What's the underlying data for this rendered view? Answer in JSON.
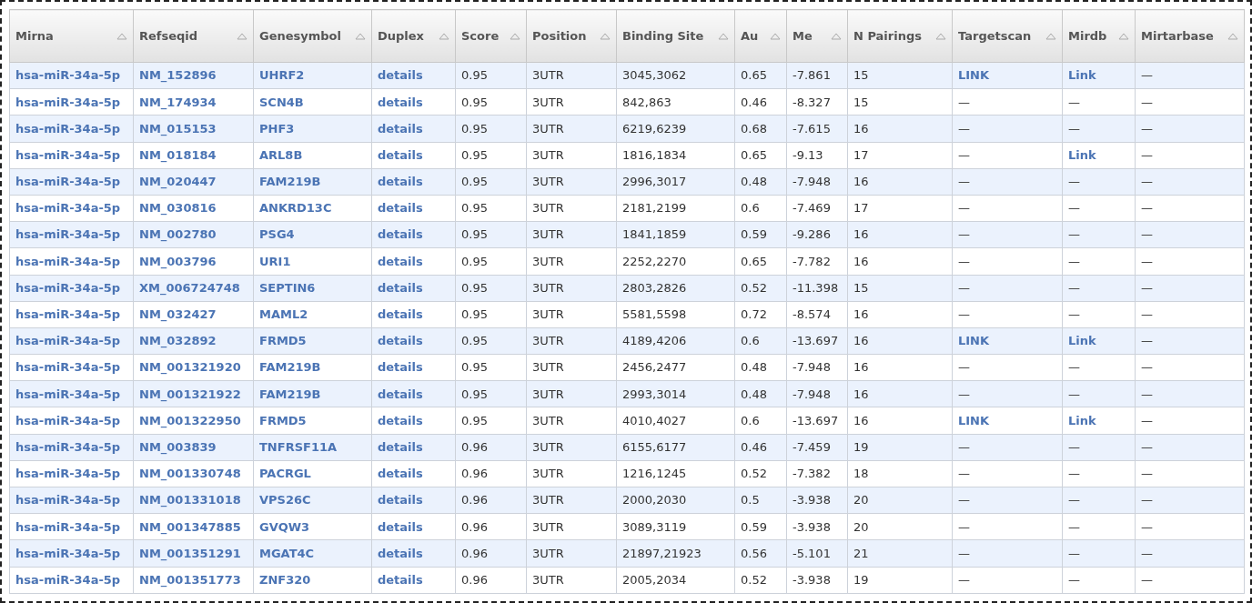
{
  "table": {
    "columns": [
      {
        "label": "Mirna",
        "kind": "link"
      },
      {
        "label": "Refseqid",
        "kind": "link"
      },
      {
        "label": "Genesymbol",
        "kind": "link"
      },
      {
        "label": "Duplex",
        "kind": "link"
      },
      {
        "label": "Score",
        "kind": "text"
      },
      {
        "label": "Position",
        "kind": "text"
      },
      {
        "label": "Binding Site",
        "kind": "text"
      },
      {
        "label": "Au",
        "kind": "text"
      },
      {
        "label": "Me",
        "kind": "text"
      },
      {
        "label": "N Pairings",
        "kind": "text"
      },
      {
        "label": "Targetscan",
        "kind": "mixed"
      },
      {
        "label": "Mirdb",
        "kind": "mixed"
      },
      {
        "label": "Mirtarbase",
        "kind": "mixed"
      }
    ],
    "rows": [
      [
        "hsa-miR-34a-5p",
        "NM_152896",
        "UHRF2",
        "details",
        "0.95",
        "3UTR",
        "3045,3062",
        "0.65",
        "-7.861",
        "15",
        {
          "text": "LINK",
          "link": true
        },
        {
          "text": "Link",
          "link": true
        },
        {
          "text": "—",
          "link": false
        }
      ],
      [
        "hsa-miR-34a-5p",
        "NM_174934",
        "SCN4B",
        "details",
        "0.95",
        "3UTR",
        "842,863",
        "0.46",
        "-8.327",
        "15",
        {
          "text": "—",
          "link": false
        },
        {
          "text": "—",
          "link": false
        },
        {
          "text": "—",
          "link": false
        }
      ],
      [
        "hsa-miR-34a-5p",
        "NM_015153",
        "PHF3",
        "details",
        "0.95",
        "3UTR",
        "6219,6239",
        "0.68",
        "-7.615",
        "16",
        {
          "text": "—",
          "link": false
        },
        {
          "text": "—",
          "link": false
        },
        {
          "text": "—",
          "link": false
        }
      ],
      [
        "hsa-miR-34a-5p",
        "NM_018184",
        "ARL8B",
        "details",
        "0.95",
        "3UTR",
        "1816,1834",
        "0.65",
        "-9.13",
        "17",
        {
          "text": "—",
          "link": false
        },
        {
          "text": "Link",
          "link": true
        },
        {
          "text": "—",
          "link": false
        }
      ],
      [
        "hsa-miR-34a-5p",
        "NM_020447",
        "FAM219B",
        "details",
        "0.95",
        "3UTR",
        "2996,3017",
        "0.48",
        "-7.948",
        "16",
        {
          "text": "—",
          "link": false
        },
        {
          "text": "—",
          "link": false
        },
        {
          "text": "—",
          "link": false
        }
      ],
      [
        "hsa-miR-34a-5p",
        "NM_030816",
        "ANKRD13C",
        "details",
        "0.95",
        "3UTR",
        "2181,2199",
        "0.6",
        "-7.469",
        "17",
        {
          "text": "—",
          "link": false
        },
        {
          "text": "—",
          "link": false
        },
        {
          "text": "—",
          "link": false
        }
      ],
      [
        "hsa-miR-34a-5p",
        "NM_002780",
        "PSG4",
        "details",
        "0.95",
        "3UTR",
        "1841,1859",
        "0.59",
        "-9.286",
        "16",
        {
          "text": "—",
          "link": false
        },
        {
          "text": "—",
          "link": false
        },
        {
          "text": "—",
          "link": false
        }
      ],
      [
        "hsa-miR-34a-5p",
        "NM_003796",
        "URI1",
        "details",
        "0.95",
        "3UTR",
        "2252,2270",
        "0.65",
        "-7.782",
        "16",
        {
          "text": "—",
          "link": false
        },
        {
          "text": "—",
          "link": false
        },
        {
          "text": "—",
          "link": false
        }
      ],
      [
        "hsa-miR-34a-5p",
        "XM_006724748",
        "SEPTIN6",
        "details",
        "0.95",
        "3UTR",
        "2803,2826",
        "0.52",
        "-11.398",
        "15",
        {
          "text": "—",
          "link": false
        },
        {
          "text": "—",
          "link": false
        },
        {
          "text": "—",
          "link": false
        }
      ],
      [
        "hsa-miR-34a-5p",
        "NM_032427",
        "MAML2",
        "details",
        "0.95",
        "3UTR",
        "5581,5598",
        "0.72",
        "-8.574",
        "16",
        {
          "text": "—",
          "link": false
        },
        {
          "text": "—",
          "link": false
        },
        {
          "text": "—",
          "link": false
        }
      ],
      [
        "hsa-miR-34a-5p",
        "NM_032892",
        "FRMD5",
        "details",
        "0.95",
        "3UTR",
        "4189,4206",
        "0.6",
        "-13.697",
        "16",
        {
          "text": "LINK",
          "link": true
        },
        {
          "text": "Link",
          "link": true
        },
        {
          "text": "—",
          "link": false
        }
      ],
      [
        "hsa-miR-34a-5p",
        "NM_001321920",
        "FAM219B",
        "details",
        "0.95",
        "3UTR",
        "2456,2477",
        "0.48",
        "-7.948",
        "16",
        {
          "text": "—",
          "link": false
        },
        {
          "text": "—",
          "link": false
        },
        {
          "text": "—",
          "link": false
        }
      ],
      [
        "hsa-miR-34a-5p",
        "NM_001321922",
        "FAM219B",
        "details",
        "0.95",
        "3UTR",
        "2993,3014",
        "0.48",
        "-7.948",
        "16",
        {
          "text": "—",
          "link": false
        },
        {
          "text": "—",
          "link": false
        },
        {
          "text": "—",
          "link": false
        }
      ],
      [
        "hsa-miR-34a-5p",
        "NM_001322950",
        "FRMD5",
        "details",
        "0.95",
        "3UTR",
        "4010,4027",
        "0.6",
        "-13.697",
        "16",
        {
          "text": "LINK",
          "link": true
        },
        {
          "text": "Link",
          "link": true
        },
        {
          "text": "—",
          "link": false
        }
      ],
      [
        "hsa-miR-34a-5p",
        "NM_003839",
        "TNFRSF11A",
        "details",
        "0.96",
        "3UTR",
        "6155,6177",
        "0.46",
        "-7.459",
        "19",
        {
          "text": "—",
          "link": false
        },
        {
          "text": "—",
          "link": false
        },
        {
          "text": "—",
          "link": false
        }
      ],
      [
        "hsa-miR-34a-5p",
        "NM_001330748",
        "PACRGL",
        "details",
        "0.96",
        "3UTR",
        "1216,1245",
        "0.52",
        "-7.382",
        "18",
        {
          "text": "—",
          "link": false
        },
        {
          "text": "—",
          "link": false
        },
        {
          "text": "—",
          "link": false
        }
      ],
      [
        "hsa-miR-34a-5p",
        "NM_001331018",
        "VPS26C",
        "details",
        "0.96",
        "3UTR",
        "2000,2030",
        "0.5",
        "-3.938",
        "20",
        {
          "text": "—",
          "link": false
        },
        {
          "text": "—",
          "link": false
        },
        {
          "text": "—",
          "link": false
        }
      ],
      [
        "hsa-miR-34a-5p",
        "NM_001347885",
        "GVQW3",
        "details",
        "0.96",
        "3UTR",
        "3089,3119",
        "0.59",
        "-3.938",
        "20",
        {
          "text": "—",
          "link": false
        },
        {
          "text": "—",
          "link": false
        },
        {
          "text": "—",
          "link": false
        }
      ],
      [
        "hsa-miR-34a-5p",
        "NM_001351291",
        "MGAT4C",
        "details",
        "0.96",
        "3UTR",
        "21897,21923",
        "0.56",
        "-5.101",
        "21",
        {
          "text": "—",
          "link": false
        },
        {
          "text": "—",
          "link": false
        },
        {
          "text": "—",
          "link": false
        }
      ],
      [
        "hsa-miR-34a-5p",
        "NM_001351773",
        "ZNF320",
        "details",
        "0.96",
        "3UTR",
        "2005,2034",
        "0.52",
        "-3.938",
        "19",
        {
          "text": "—",
          "link": false
        },
        {
          "text": "—",
          "link": false
        },
        {
          "text": "—",
          "link": false
        }
      ]
    ]
  }
}
